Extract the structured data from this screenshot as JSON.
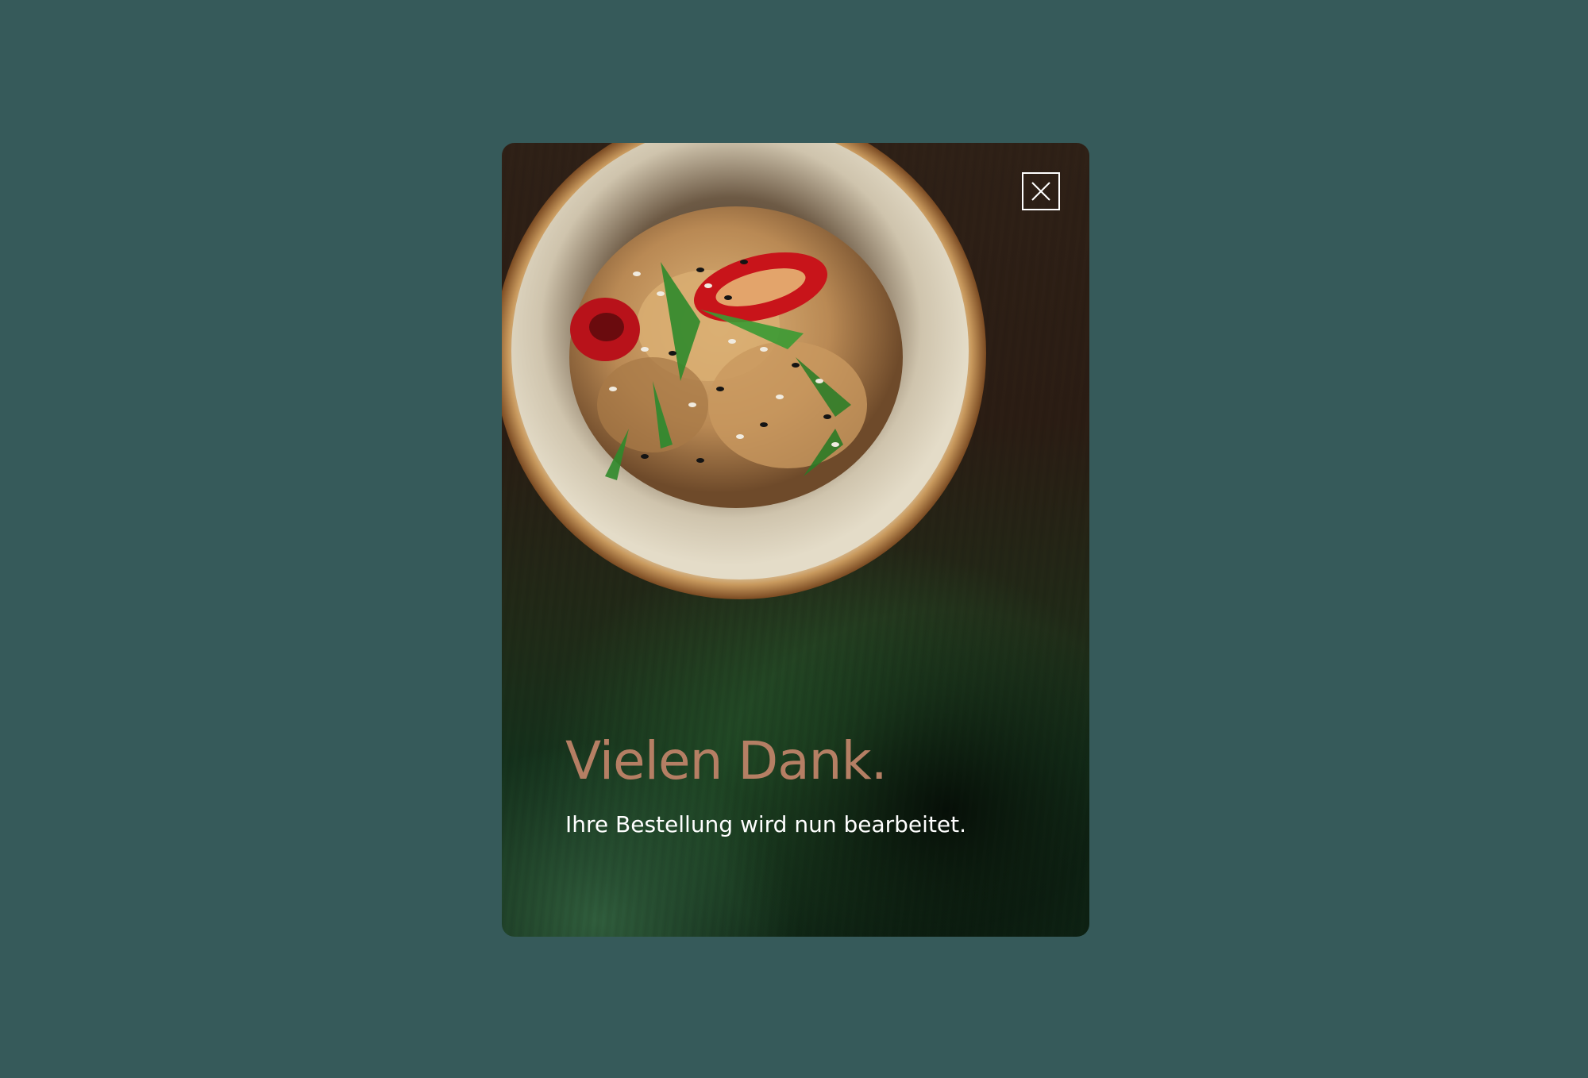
{
  "dialog": {
    "title": "Vielen Dank.",
    "message": "Ihre Bestellung wird nun bearbeitet.",
    "close_label": "close-icon",
    "image": "bowl-food-photo"
  },
  "colors": {
    "backdrop": "#365a5a",
    "title": "#b57f64",
    "message": "#ffffff"
  }
}
